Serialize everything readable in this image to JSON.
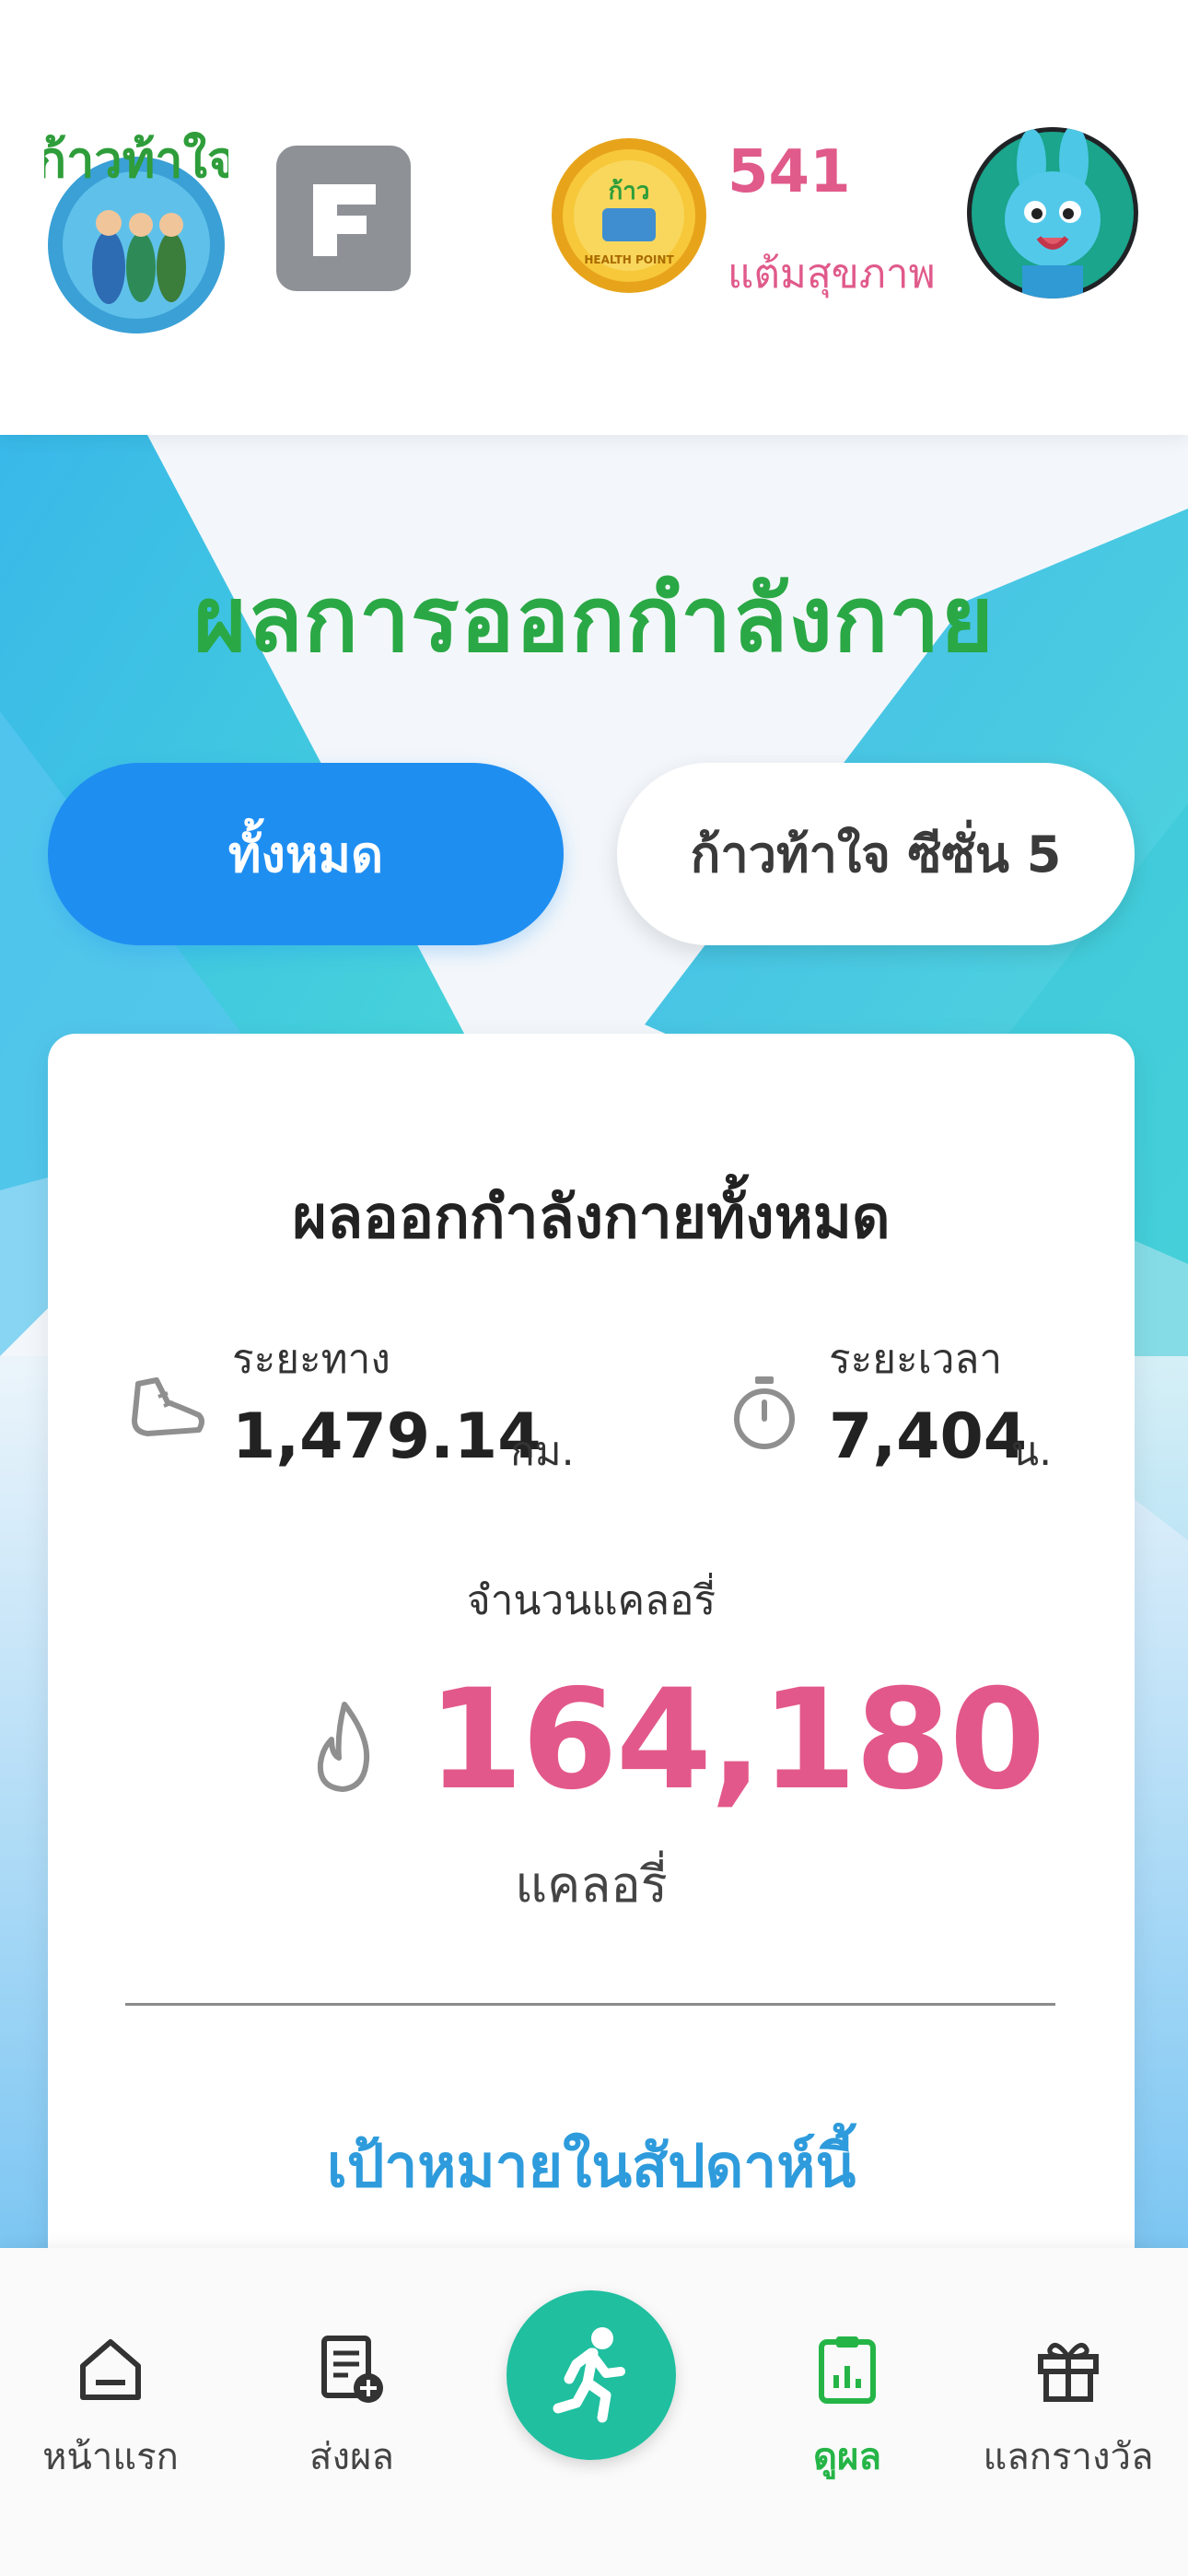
{
  "header": {
    "logo_text": "ก้าวท้าใจ",
    "coin_text": "ก้าวท้าใจ HEALTH POINT",
    "points_value": "541",
    "points_label": "แต้มสุขภาพ"
  },
  "main": {
    "title": "ผลการออกกำลังกาย",
    "tabs": [
      {
        "label": "ทั้งหมด",
        "active": true
      },
      {
        "label": "ก้าวท้าใจ ซีซั่น 5",
        "active": false
      }
    ]
  },
  "summary": {
    "title": "ผลออกกำลังกายทั้งหมด",
    "distance": {
      "label": "ระยะทาง",
      "value": "1,479.14",
      "unit": "กม."
    },
    "duration": {
      "label": "ระยะเวลา",
      "value": "7,404",
      "unit": "น."
    },
    "calories": {
      "label": "จำนวนแคลอรี่",
      "value": "164,180",
      "unit": "แคลอรี่"
    },
    "goal_title": "เป้าหมายในสัปดาห์นี้"
  },
  "nav": {
    "items": [
      {
        "label": "หน้าแรก",
        "icon": "home-icon"
      },
      {
        "label": "ส่งผล",
        "icon": "submit-result-icon"
      },
      {
        "label": "ดูผล",
        "icon": "view-results-icon",
        "active": true
      },
      {
        "label": "แลกรางวัล",
        "icon": "gift-icon"
      }
    ],
    "center_icon": "running-icon"
  },
  "colors": {
    "accent_blue": "#1f8ef1",
    "title_green": "#2aa845",
    "pink": "#e3588a",
    "teal": "#1fbf9f",
    "goal_blue": "#2e9bdc"
  }
}
